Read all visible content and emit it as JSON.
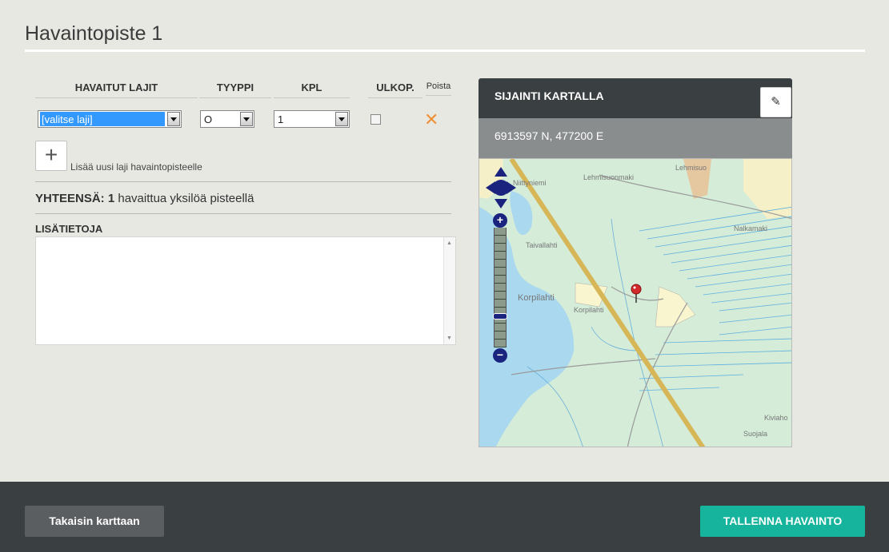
{
  "page": {
    "title": "Havaintopiste 1"
  },
  "table": {
    "headers": {
      "species": "HAVAITUT LAJIT",
      "type": "TYYPPI",
      "count": "KPL",
      "outside": "ULKOP.",
      "remove": "Poista"
    },
    "row": {
      "species_value": "[valitse laji]",
      "type_value": "O",
      "count_value": "1",
      "outside_checked": false
    }
  },
  "add": {
    "label": "Lisää uusi laji havaintopisteelle",
    "button_symbol": "+"
  },
  "total": {
    "prefix": "YHTEENSÄ:",
    "count": "1",
    "suffix": "havaittua yksilöä pisteellä"
  },
  "info": {
    "label": "LISÄTIETOJA",
    "value": ""
  },
  "map": {
    "header": "SIJAINTI KARTALLA",
    "coordinates": "6913597 N, 477200 E",
    "place_labels": [
      "Lehmisuonmaki",
      "Lehmisuo",
      "Niittyniemi",
      "Taivallahti",
      "Nalkamaki",
      "Korpilahti",
      "Korpilahti",
      "Kiviaho",
      "Suojala"
    ],
    "zoom_plus": "+",
    "zoom_minus": "−",
    "zoom_level": 0.25
  },
  "footer": {
    "back_label": "Takaisin karttaan",
    "save_label": "TALLENNA HAVAINTO"
  },
  "colors": {
    "accent": "#16b49c",
    "remove": "#f0913a",
    "header_dark": "#3a3f41"
  }
}
